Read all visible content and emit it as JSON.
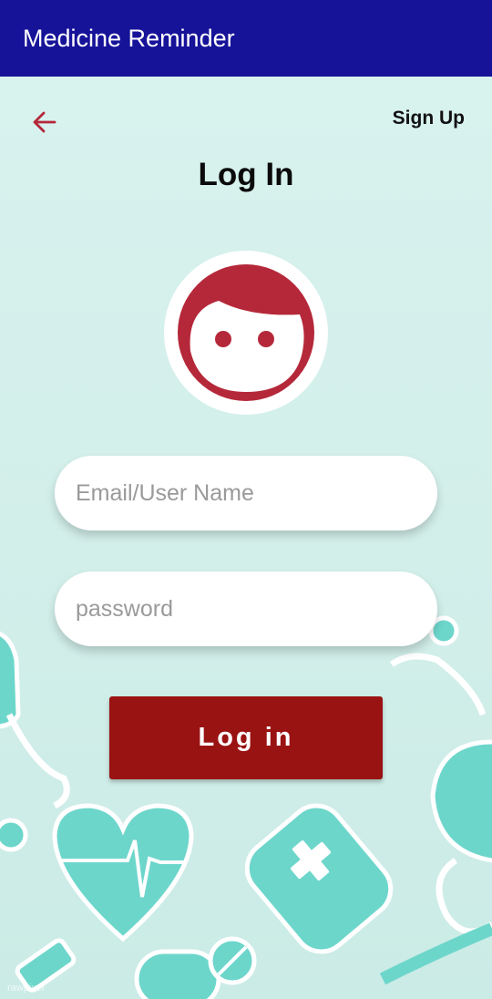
{
  "appbar": {
    "title": "Medicine Reminder"
  },
  "header": {
    "signup_label": "Sign Up"
  },
  "page": {
    "title": "Log In"
  },
  "form": {
    "email_placeholder": "Email/User Name",
    "password_placeholder": "password",
    "email_value": "",
    "password_value": "",
    "login_label": "Log in"
  },
  "background": {
    "watermark": "rawpixel"
  },
  "colors": {
    "appbar": "#161399",
    "accent_red": "#b5283a",
    "button": "#9a1313",
    "background": "#d4efea",
    "teal_art": "#6dd6cb"
  },
  "icons": {
    "back": "arrow-left-icon",
    "avatar": "face-icon"
  }
}
